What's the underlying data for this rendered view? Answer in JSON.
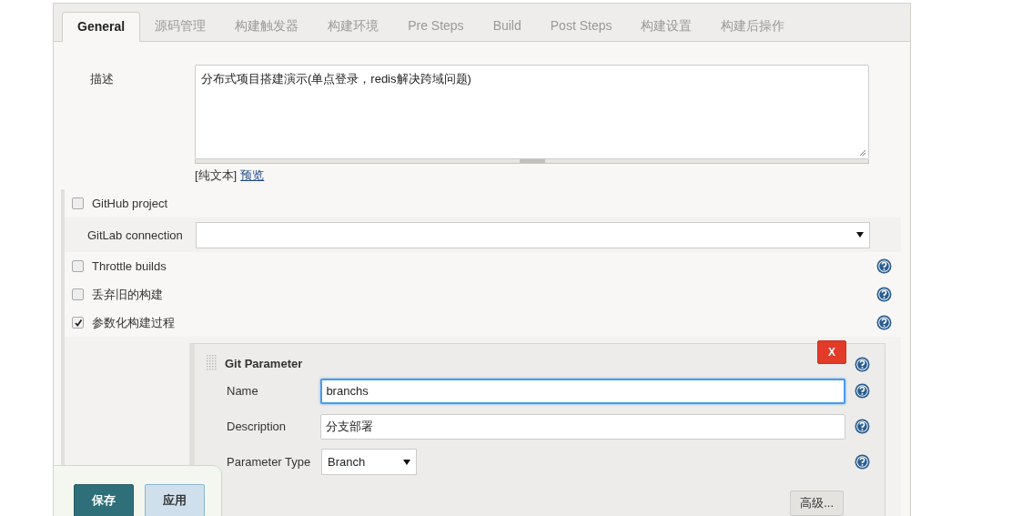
{
  "tabs": [
    {
      "label": "General",
      "selected": true
    },
    {
      "label": "源码管理",
      "selected": false
    },
    {
      "label": "构建触发器",
      "selected": false
    },
    {
      "label": "构建环境",
      "selected": false
    },
    {
      "label": "Pre Steps",
      "selected": false
    },
    {
      "label": "Build",
      "selected": false
    },
    {
      "label": "Post Steps",
      "selected": false
    },
    {
      "label": "构建设置",
      "selected": false
    },
    {
      "label": "构建后操作",
      "selected": false
    }
  ],
  "description": {
    "label": "描述",
    "value": "分布式项目搭建演示(单点登录，redis解决跨域问题)",
    "format_note": "[纯文本]",
    "preview_link": "预览"
  },
  "options": [
    {
      "kind": "checkbox",
      "label": "GitHub project",
      "checked": false,
      "help": false
    },
    {
      "kind": "select",
      "label": "GitLab connection",
      "help": false
    },
    {
      "kind": "checkbox",
      "label": "Throttle builds",
      "checked": false,
      "help": true
    },
    {
      "kind": "checkbox",
      "label": "丢弃旧的构建",
      "checked": false,
      "help": true
    },
    {
      "kind": "checkbox",
      "label": "参数化构建过程",
      "checked": true,
      "help": true
    }
  ],
  "parameter": {
    "title": "Git Parameter",
    "delete_label": "X",
    "fields": [
      {
        "kind": "text",
        "label": "Name",
        "value": "branchs",
        "focused": true
      },
      {
        "kind": "text",
        "label": "Description",
        "value": "分支部署",
        "focused": false
      },
      {
        "kind": "select",
        "label": "Parameter Type",
        "value": "Branch"
      }
    ],
    "advanced_button": "高级..."
  },
  "buttons": [
    {
      "kind": "primary",
      "label": "保存"
    },
    {
      "kind": "secondary",
      "label": "应用"
    }
  ]
}
